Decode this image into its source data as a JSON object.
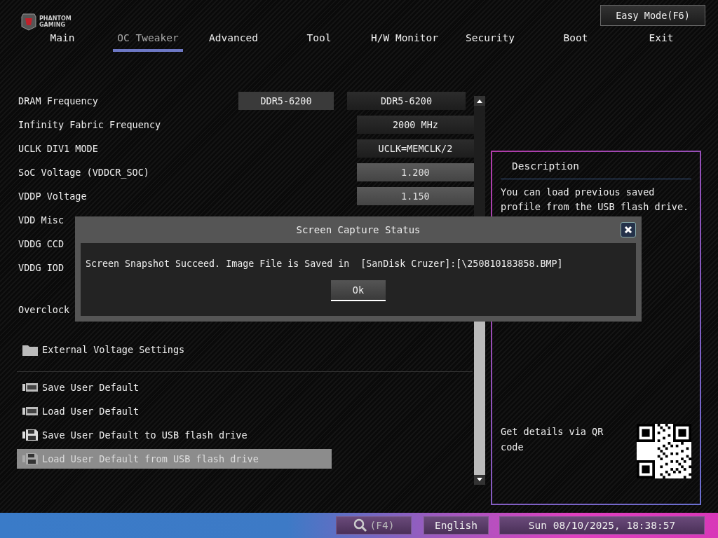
{
  "logo": {
    "lines": [
      "PHANTOM",
      "GAMING"
    ]
  },
  "easy_mode_button": "Easy Mode(F6)",
  "tabs": [
    {
      "label": "Main",
      "selected": false
    },
    {
      "label": "OC Tweaker",
      "selected": true
    },
    {
      "label": "Advanced",
      "selected": false
    },
    {
      "label": "Tool",
      "selected": false
    },
    {
      "label": "H/W Monitor",
      "selected": false
    },
    {
      "label": "Security",
      "selected": false
    },
    {
      "label": "Boot",
      "selected": false
    },
    {
      "label": "Exit",
      "selected": false
    }
  ],
  "settings": [
    {
      "label": "DRAM Frequency",
      "current": "DDR5-6200",
      "value": "DDR5-6200",
      "kind": "option"
    },
    {
      "label": "Infinity Fabric Frequency",
      "value": "2000 MHz",
      "kind": "option"
    },
    {
      "label": "UCLK DIV1 MODE",
      "value": "UCLK=MEMCLK/2",
      "kind": "option"
    },
    {
      "label": "SoC Voltage (VDDCR_SOC)",
      "value": "1.200",
      "kind": "input"
    },
    {
      "label": "VDDP Voltage",
      "value": "1.150",
      "kind": "input"
    },
    {
      "label": "VDD Misc",
      "kind": "input"
    },
    {
      "label": "VDDG CCD",
      "kind": "input"
    },
    {
      "label": "VDDG IOD",
      "kind": "input"
    },
    {
      "label": "Overclock",
      "kind": "gap"
    }
  ],
  "folder": {
    "label": "External Voltage Settings"
  },
  "actions": [
    {
      "label": "Save User Default",
      "kind": "bios",
      "selected": false
    },
    {
      "label": "Load User Default",
      "kind": "bios",
      "selected": false
    },
    {
      "label": "Save User Default to USB flash drive",
      "kind": "usb",
      "selected": false
    },
    {
      "label": "Load User Default from USB flash drive",
      "kind": "usb",
      "selected": true
    }
  ],
  "description": {
    "title": "Description",
    "text": "You can load previous saved profile from the USB flash drive.",
    "qr_label": "Get details via QR code"
  },
  "dialog": {
    "title": "Screen Capture Status",
    "message": "Screen Snapshot Succeed. Image File is Saved in  [SanDisk Cruzer]:[\\250810183858.BMP]",
    "ok_button": "Ok"
  },
  "status_bar": {
    "search_key": "(F4)",
    "language": "English",
    "datetime": "Sun 08/10/2025, 18:38:57"
  }
}
